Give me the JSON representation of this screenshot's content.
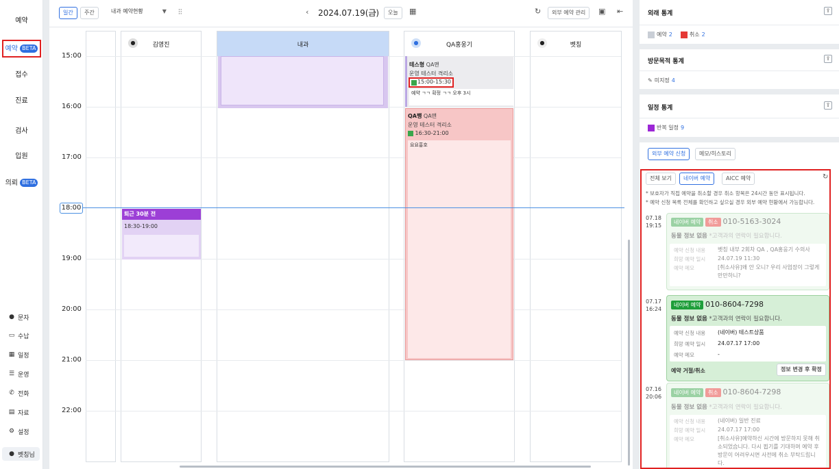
{
  "sidebar": {
    "nav": [
      {
        "label": "예약"
      },
      {
        "label": "예약",
        "badge": "BETA"
      },
      {
        "label": "접수"
      },
      {
        "label": "진료"
      },
      {
        "label": "검사"
      },
      {
        "label": "입원"
      },
      {
        "label": "의뢰",
        "badge": "BETA"
      }
    ],
    "tools": [
      {
        "label": "문자",
        "icon": "chat-icon"
      },
      {
        "label": "수납",
        "icon": "card-icon"
      },
      {
        "label": "일정",
        "icon": "calendar-icon"
      },
      {
        "label": "운영",
        "icon": "list-icon"
      },
      {
        "label": "전화",
        "icon": "phone-icon"
      },
      {
        "label": "자료",
        "icon": "document-icon"
      },
      {
        "label": "설정",
        "icon": "gear-icon"
      },
      {
        "label": "벳칭님",
        "icon": "user-icon"
      }
    ]
  },
  "toolbar": {
    "day": "일간",
    "week": "주간",
    "view_select": "내과 예약현황",
    "date": "2024.07.19(금)",
    "today": "오늘",
    "external_manage": "외부 예약 관리"
  },
  "columns": [
    {
      "name": "김영진"
    },
    {
      "name": "내과"
    },
    {
      "name": "QA홍웅기"
    },
    {
      "name": "벳칭"
    }
  ],
  "times": [
    "15:00",
    "16:00",
    "17:00",
    "18:00",
    "19:00",
    "20:00",
    "21:00",
    "22:00"
  ],
  "now_time": "18:00",
  "appointments": {
    "a1": {
      "name": "테스형",
      "tag": "QA맨",
      "clinic": "운영 테스터 격리소",
      "time": "15:00-15:30",
      "memo": "예약 ㄱㄱ 확정 ㄱㄱ 오후 3시"
    },
    "a2": {
      "name": "QA쨍",
      "tag": "QA맨",
      "clinic": "운영 테스터 격리소",
      "time": "16:30-21:00",
      "memo": "요요홍호"
    },
    "a3": {
      "title": "퇴근 30분 전",
      "time": "18:30-19:00"
    }
  },
  "right": {
    "visit_stats": {
      "title": "외래 통계",
      "reserved_label": "예약",
      "reserved_count": "2",
      "cancel_label": "취소",
      "cancel_count": "2",
      "reserved_color": "#c9ced6",
      "cancel_color": "#e53935"
    },
    "purpose_stats": {
      "title": "방문목적 통계",
      "item_label": "미지정",
      "item_count": "4"
    },
    "schedule_stats": {
      "title": "일정 통계",
      "item_label": "반복 일정",
      "item_count": "9",
      "item_color": "#9c27d6"
    },
    "tabs": {
      "external": "외부 예약 신청",
      "memo": "메모/히스토리"
    },
    "filters": {
      "all": "전체 보기",
      "naver": "네이버 예약",
      "aicc": "AICC 예약"
    },
    "notes": [
      "* 보호자가 직접 예약을 취소할 경우 취소 항목은 24시간 동안 표시됩니다.",
      "* 예약 신청 목록 전체를 확인하고 싶으실 경우 외부 예약 현황에서 가능합니다."
    ],
    "labels": {
      "req": "예약 신청 내용",
      "want": "희망 예약 일시",
      "memo": "예약 메모",
      "no_animal": "동물 정보 없음",
      "need_contact": "*고객과의 연락이 필요합니다."
    },
    "reservations": [
      {
        "date": "07.18",
        "time": "19:15",
        "badge": "네이버 예약",
        "status": "취소",
        "phone": "010-5163-3024",
        "req": "벳칭 내부 2회차 QA , QA홍웅기 수의사",
        "want": "24.07.19 11:30",
        "memo": "[취소사유]왜 안 오니? 우리 사업장이 그렇게 만만하니?"
      },
      {
        "date": "07.17",
        "time": "16:24",
        "badge": "네이버 예약",
        "phone": "010-8604-7298",
        "req": "(네이버) 테스트상품",
        "want": "24.07.17 17:00",
        "memo": "-",
        "reject": "예약 거절/취소",
        "confirm": "정보 변경 후 확정"
      },
      {
        "date": "07.16",
        "time": "20:06",
        "badge": "네이버 예약",
        "status": "취소",
        "phone": "010-8604-7298",
        "req": "(네이버) 일반 진료",
        "want": "24.07.17 17:00",
        "memo": "[취소사유]예약하신 시간에 방문하지 못해 취소되었습니다. 다시 뵙기를 기대하며 예약 후 방문이 어려우시면 사전에 취소 부탁드립니다."
      }
    ]
  }
}
